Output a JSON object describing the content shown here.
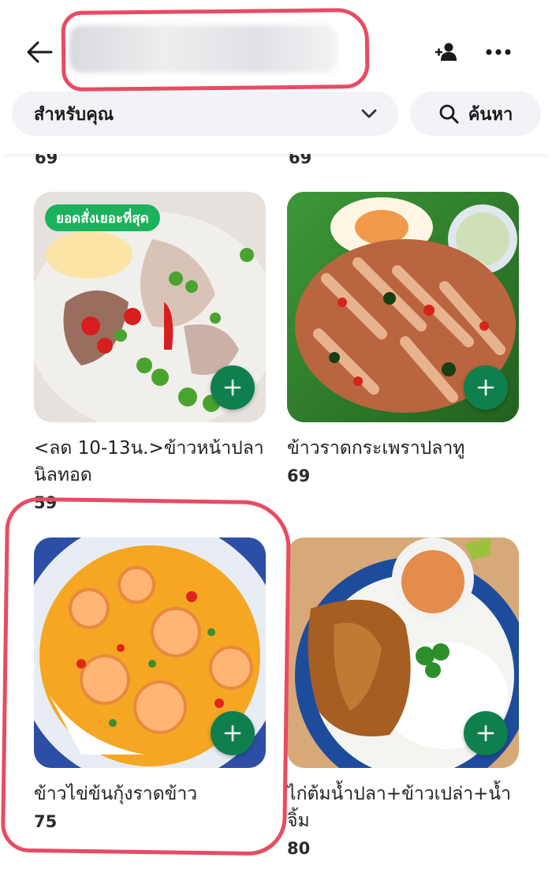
{
  "header": {
    "back_icon": "arrow-left-icon",
    "group_icon": "add-group-icon",
    "more_icon": "more-dots-icon"
  },
  "filter": {
    "category_label": "สำหรับคุณ",
    "search_label": "ค้นหา"
  },
  "previous_row": {
    "prices": [
      "69",
      "69"
    ]
  },
  "menu_items": [
    {
      "name": "<ลด 10-13น.>ข้าวหน้าปลานิลทอด",
      "price": "59",
      "badge": "ยอดสั่งเยอะที่สุด"
    },
    {
      "name": "ข้าวราดกระเพราปลาทู",
      "price": "69"
    },
    {
      "name": "ข้าวไข่ข้นกุ้งราดข้าว",
      "price": "75"
    },
    {
      "name": "ไก่ต้มน้ำปลา+ข้าวเปล่า+น้ำจิ้ม",
      "price": "80"
    }
  ],
  "colors": {
    "accent_green": "#0f7f4e",
    "badge_green": "#1bb25b",
    "annotation_red": "#e94b63",
    "pill_bg": "#f1f3f6"
  }
}
